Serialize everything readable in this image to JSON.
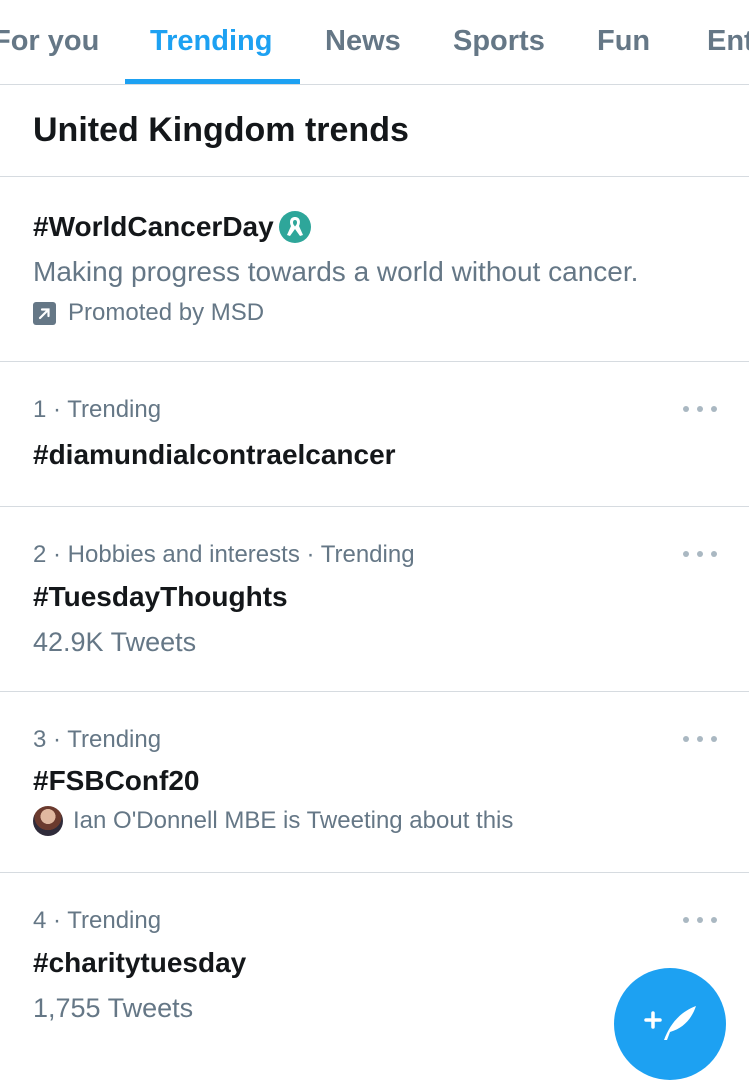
{
  "tabs": [
    {
      "label": "For you"
    },
    {
      "label": "Trending"
    },
    {
      "label": "News"
    },
    {
      "label": "Sports"
    },
    {
      "label": "Fun"
    },
    {
      "label": "Ent"
    }
  ],
  "active_tab": "Trending",
  "section_title": "United Kingdom trends",
  "promoted": {
    "hashtag": "#WorldCancerDay",
    "description": "Making progress towards a world without cancer.",
    "promoted_by": "Promoted by MSD",
    "badge_icon": "ribbon-badge-icon",
    "promo_icon": "arrow-up-right-icon"
  },
  "trends": [
    {
      "meta": "1 · Trending",
      "name": "#diamundialcontraelcancer"
    },
    {
      "meta": "2 · Hobbies and interests · Trending",
      "name": "#TuesdayThoughts",
      "count": "42.9K Tweets"
    },
    {
      "meta": "3 · Trending",
      "name": "#FSBConf20",
      "context": "Ian O'Donnell MBE is Tweeting about this"
    },
    {
      "meta": "4 · Trending",
      "name": "#charitytuesday",
      "count": "1,755 Tweets"
    }
  ],
  "colors": {
    "accent": "#1da1f2",
    "text_primary": "#14171a",
    "text_secondary": "#657786",
    "divider": "#d6dbe0",
    "badge": "#2ea69a"
  },
  "fab": {
    "icon": "compose-tweet-icon"
  }
}
